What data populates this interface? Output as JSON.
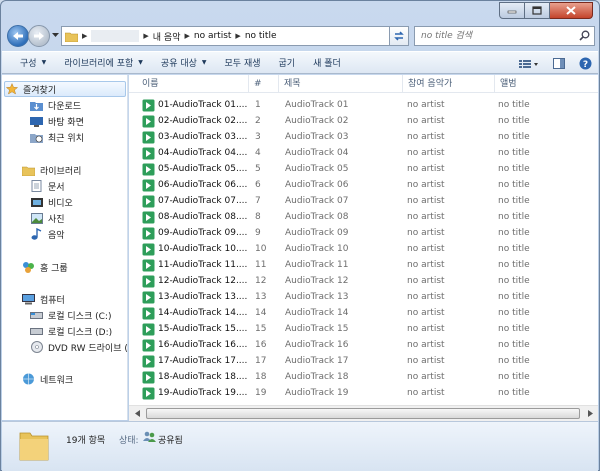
{
  "address": {
    "segments": [
      "내 음악",
      "no artist",
      "no title"
    ]
  },
  "search": {
    "placeholder": "no title 검색"
  },
  "toolbar": {
    "organize": "구성",
    "include_library": "라이브러리에 포함",
    "share_with": "공유 대상",
    "play_all": "모두 재생",
    "burn": "굽기",
    "new_folder": "새 폴더"
  },
  "nav": {
    "favorites": "즐겨찾기",
    "downloads": "다운로드",
    "desktop": "바탕 화면",
    "recent": "최근 위치",
    "libraries": "라이브러리",
    "documents": "문서",
    "videos": "비디오",
    "pictures": "사진",
    "music": "음악",
    "homegroup": "홈 그룹",
    "computer": "컴퓨터",
    "drive_c": "로컬 디스크 (C:)",
    "drive_d": "로컬 디스크 (D:)",
    "dvd": "DVD RW 드라이브 (",
    "network": "네트워크"
  },
  "columns": {
    "name": "이름",
    "number": "#",
    "title": "제목",
    "artist": "참여 음악가",
    "album": "앨범"
  },
  "files": [
    {
      "name": "01-AudioTrack 01....",
      "num": "1",
      "title": "AudioTrack 01",
      "artist": "no artist",
      "album": "no title"
    },
    {
      "name": "02-AudioTrack 02....",
      "num": "2",
      "title": "AudioTrack 02",
      "artist": "no artist",
      "album": "no title"
    },
    {
      "name": "03-AudioTrack 03....",
      "num": "3",
      "title": "AudioTrack 03",
      "artist": "no artist",
      "album": "no title"
    },
    {
      "name": "04-AudioTrack 04....",
      "num": "4",
      "title": "AudioTrack 04",
      "artist": "no artist",
      "album": "no title"
    },
    {
      "name": "05-AudioTrack 05....",
      "num": "5",
      "title": "AudioTrack 05",
      "artist": "no artist",
      "album": "no title"
    },
    {
      "name": "06-AudioTrack 06....",
      "num": "6",
      "title": "AudioTrack 06",
      "artist": "no artist",
      "album": "no title"
    },
    {
      "name": "07-AudioTrack 07....",
      "num": "7",
      "title": "AudioTrack 07",
      "artist": "no artist",
      "album": "no title"
    },
    {
      "name": "08-AudioTrack 08....",
      "num": "8",
      "title": "AudioTrack 08",
      "artist": "no artist",
      "album": "no title"
    },
    {
      "name": "09-AudioTrack 09....",
      "num": "9",
      "title": "AudioTrack 09",
      "artist": "no artist",
      "album": "no title"
    },
    {
      "name": "10-AudioTrack 10....",
      "num": "10",
      "title": "AudioTrack 10",
      "artist": "no artist",
      "album": "no title"
    },
    {
      "name": "11-AudioTrack 11....",
      "num": "11",
      "title": "AudioTrack 11",
      "artist": "no artist",
      "album": "no title"
    },
    {
      "name": "12-AudioTrack 12....",
      "num": "12",
      "title": "AudioTrack 12",
      "artist": "no artist",
      "album": "no title"
    },
    {
      "name": "13-AudioTrack 13....",
      "num": "13",
      "title": "AudioTrack 13",
      "artist": "no artist",
      "album": "no title"
    },
    {
      "name": "14-AudioTrack 14....",
      "num": "14",
      "title": "AudioTrack 14",
      "artist": "no artist",
      "album": "no title"
    },
    {
      "name": "15-AudioTrack 15....",
      "num": "15",
      "title": "AudioTrack 15",
      "artist": "no artist",
      "album": "no title"
    },
    {
      "name": "16-AudioTrack 16....",
      "num": "16",
      "title": "AudioTrack 16",
      "artist": "no artist",
      "album": "no title"
    },
    {
      "name": "17-AudioTrack 17....",
      "num": "17",
      "title": "AudioTrack 17",
      "artist": "no artist",
      "album": "no title"
    },
    {
      "name": "18-AudioTrack 18....",
      "num": "18",
      "title": "AudioTrack 18",
      "artist": "no artist",
      "album": "no title"
    },
    {
      "name": "19-AudioTrack 19....",
      "num": "19",
      "title": "AudioTrack 19",
      "artist": "no artist",
      "album": "no title"
    }
  ],
  "details": {
    "count": "19개 항목",
    "state_label": "상태:",
    "state_value": "공유됨"
  },
  "colors": {
    "file_icon": "#2e9e5a",
    "accent": "#3d6fa8"
  }
}
